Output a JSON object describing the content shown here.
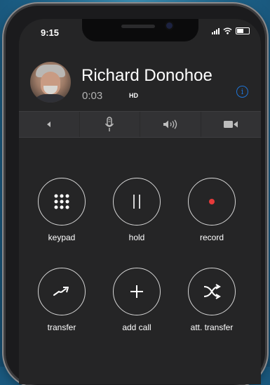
{
  "status_bar": {
    "time": "9:15"
  },
  "caller": {
    "name": "Richard Donohoe",
    "duration": "0:03",
    "quality": "HD"
  },
  "icons": {
    "info": "info-icon",
    "toolbar": [
      "speaker-left-icon",
      "microphone-icon",
      "volume-icon",
      "video-camera-icon"
    ]
  },
  "actions": [
    {
      "label": "keypad",
      "icon": "keypad-icon"
    },
    {
      "label": "hold",
      "icon": "pause-icon"
    },
    {
      "label": "record",
      "icon": "record-icon"
    },
    {
      "label": "transfer",
      "icon": "transfer-arrow-icon"
    },
    {
      "label": "add call",
      "icon": "plus-icon"
    },
    {
      "label": "att. transfer",
      "icon": "cross-arrows-icon"
    }
  ],
  "colors": {
    "accent": "#1f74d6",
    "record": "#e63a3a"
  }
}
